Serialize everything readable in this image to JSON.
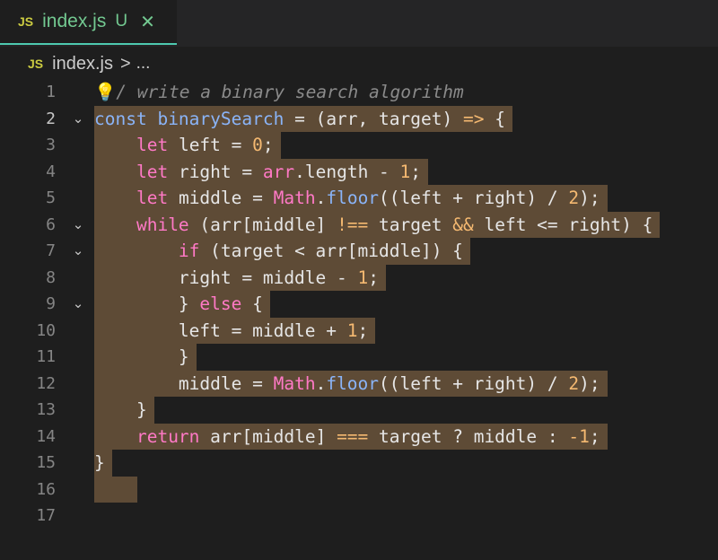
{
  "tab": {
    "icon": "JS",
    "filename": "index.js",
    "status": "U",
    "close": "✕"
  },
  "breadcrumb": {
    "icon": "JS",
    "file": "index.js",
    "separator": ">",
    "more": "..."
  },
  "lines": [
    {
      "n": "1",
      "text": "/ write a binary search algorithm"
    },
    {
      "n": "2",
      "text": "const binarySearch = (arr, target) => {"
    },
    {
      "n": "3",
      "text": "    let left = 0;"
    },
    {
      "n": "4",
      "text": "    let right = arr.length - 1;"
    },
    {
      "n": "5",
      "text": "    let middle = Math.floor((left + right) / 2);"
    },
    {
      "n": "6",
      "text": "    while (arr[middle] !== target && left <= right) {"
    },
    {
      "n": "7",
      "text": "        if (target < arr[middle]) {"
    },
    {
      "n": "8",
      "text": "        right = middle - 1;"
    },
    {
      "n": "9",
      "text": "        } else {"
    },
    {
      "n": "10",
      "text": "        left = middle + 1;"
    },
    {
      "n": "11",
      "text": "        }"
    },
    {
      "n": "12",
      "text": "        middle = Math.floor((left + right) / 2);"
    },
    {
      "n": "13",
      "text": "    }"
    },
    {
      "n": "14",
      "text": "    return arr[middle] === target ? middle : -1;"
    },
    {
      "n": "15",
      "text": "}"
    },
    {
      "n": "16",
      "text": ""
    },
    {
      "n": "17",
      "text": ""
    }
  ],
  "fold_icon": "chevron-down",
  "bulb_icon": "lightbulb",
  "colors": {
    "selection": "#5e4b36",
    "tab_accent": "#4ec9b0",
    "modified": "#73c991",
    "keyword": "#ff79c6",
    "number": "#f5b971",
    "function": "#8ab4f8"
  }
}
